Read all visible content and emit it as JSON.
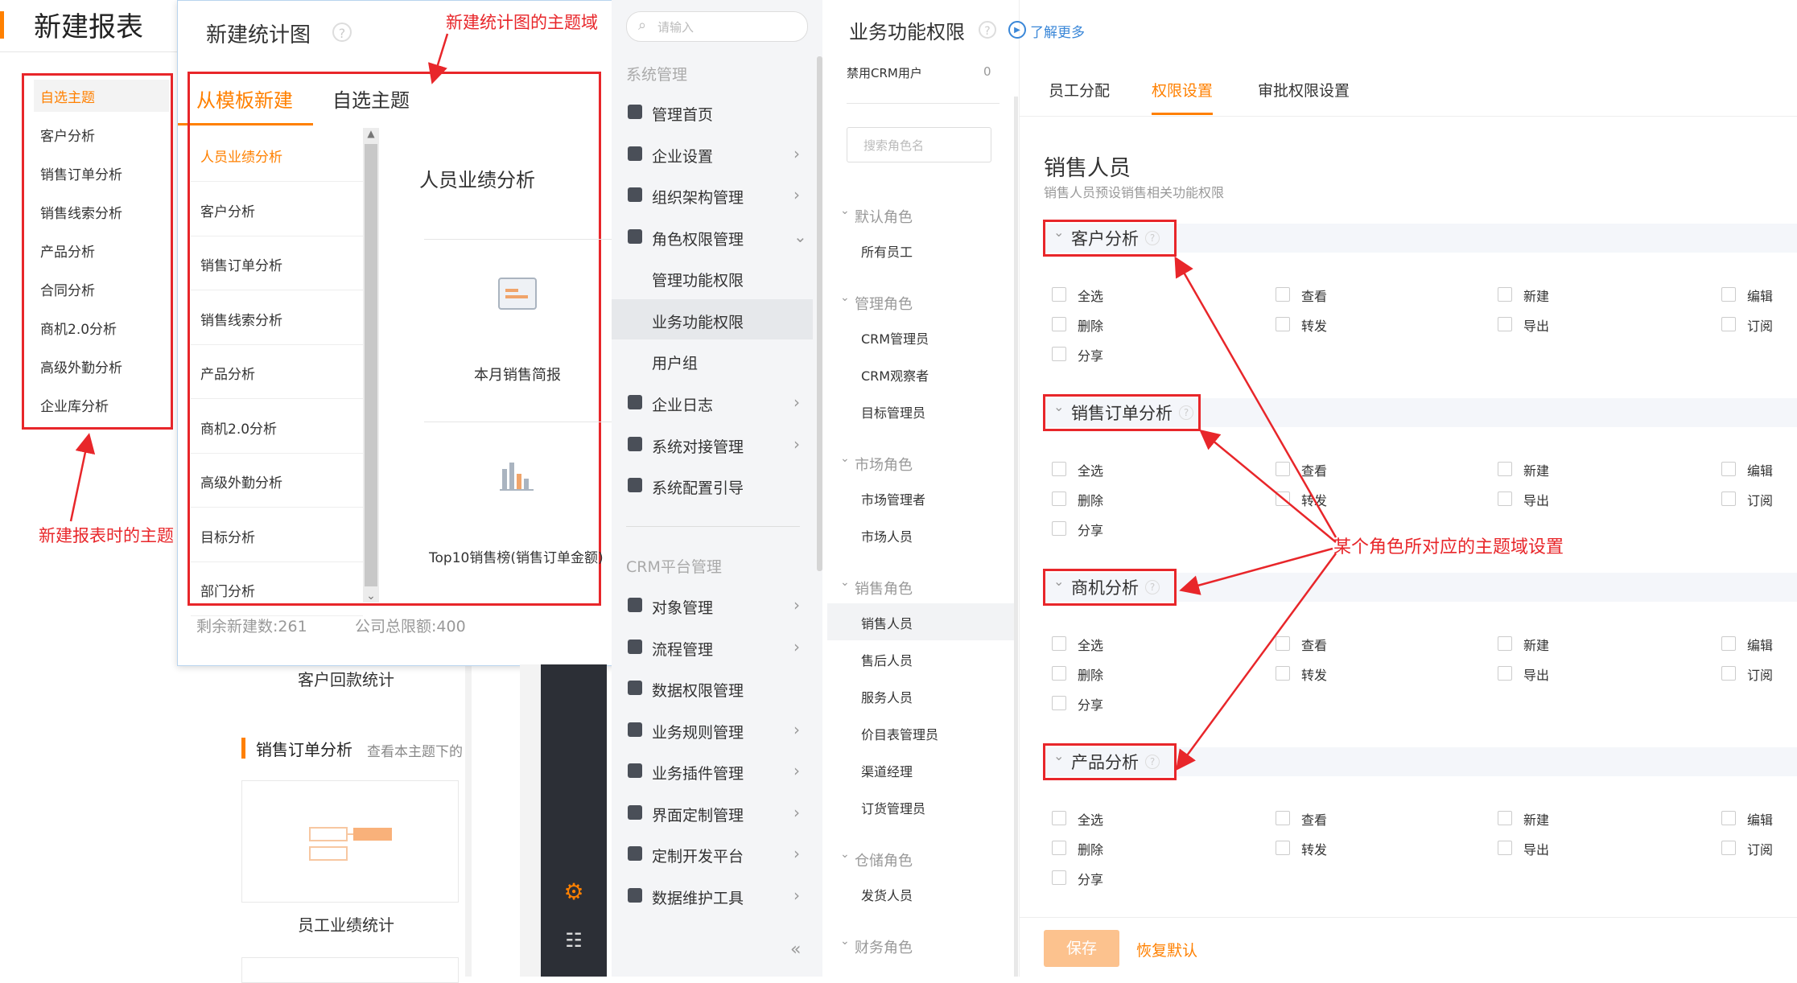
{
  "left_panel": {
    "title": "新建报表",
    "topics": [
      "自选主题",
      "客户分析",
      "销售订单分析",
      "销售线索分析",
      "产品分析",
      "合同分析",
      "商机2.0分析",
      "高级外勤分析",
      "企业库分析"
    ],
    "annotation": "新建报表时的主题",
    "card_customer_payment": "客户回款统计",
    "section_title": "销售订单分析",
    "section_hint": "查看本主题下的",
    "card_employee": "员工业绩统计"
  },
  "dialog": {
    "title": "新建统计图",
    "annotation": "新建统计图的主题域",
    "tab_template": "从模板新建",
    "tab_custom": "自选主题",
    "list": [
      "人员业绩分析",
      "客户分析",
      "销售订单分析",
      "销售线索分析",
      "产品分析",
      "商机2.0分析",
      "高级外勤分析",
      "目标分析",
      "部门分析"
    ],
    "preview_title": "人员业绩分析",
    "card_month": "本月销售简报",
    "card_top10": "Top10销售榜(销售订单金额)",
    "remaining": "剩余新建数:261",
    "limit": "公司总限额:400"
  },
  "sidebar": {
    "search_placeholder": "请输入",
    "group1": "系统管理",
    "items1": [
      {
        "label": "管理首页",
        "icon": "home-icon",
        "arrow": ""
      },
      {
        "label": "企业设置",
        "icon": "building-icon",
        "arrow": "›"
      },
      {
        "label": "组织架构管理",
        "icon": "org-icon",
        "arrow": "›"
      },
      {
        "label": "角色权限管理",
        "icon": "user-card-icon",
        "arrow": "⌄"
      }
    ],
    "sub_items": [
      "管理功能权限",
      "业务功能权限",
      "用户组"
    ],
    "items2": [
      {
        "label": "企业日志",
        "icon": "log-icon",
        "arrow": "›"
      },
      {
        "label": "系统对接管理",
        "icon": "link-icon",
        "arrow": "›"
      },
      {
        "label": "系统配置引导",
        "icon": "sliders-icon",
        "arrow": ""
      }
    ],
    "group2": "CRM平台管理",
    "items3": [
      {
        "label": "对象管理",
        "icon": "person-icon",
        "arrow": "›"
      },
      {
        "label": "流程管理",
        "icon": "flow-icon",
        "arrow": "›"
      },
      {
        "label": "数据权限管理",
        "icon": "lock-icon",
        "arrow": ""
      },
      {
        "label": "业务规则管理",
        "icon": "wrench-icon",
        "arrow": "›"
      },
      {
        "label": "业务插件管理",
        "icon": "puzzle-icon",
        "arrow": "›"
      },
      {
        "label": "界面定制管理",
        "icon": "brush-icon",
        "arrow": "›"
      },
      {
        "label": "定制开发平台",
        "icon": "monitor-icon",
        "arrow": "›"
      },
      {
        "label": "数据维护工具",
        "icon": "chart-icon",
        "arrow": "›"
      }
    ],
    "collapse": "«"
  },
  "roles": {
    "disabled_label": "禁用CRM用户",
    "disabled_count": "0",
    "search_placeholder": "搜索角色名",
    "groups": [
      {
        "name": "默认角色",
        "roles": [
          "所有员工"
        ]
      },
      {
        "name": "管理角色",
        "roles": [
          "CRM管理员",
          "CRM观察者",
          "目标管理员"
        ]
      },
      {
        "name": "市场角色",
        "roles": [
          "市场管理者",
          "市场人员"
        ]
      },
      {
        "name": "销售角色",
        "roles": [
          "销售人员",
          "售后人员",
          "服务人员",
          "价目表管理员",
          "渠道经理",
          "订货管理员"
        ]
      },
      {
        "name": "仓储角色",
        "roles": [
          "发货人员"
        ]
      },
      {
        "name": "财务角色",
        "roles": []
      }
    ]
  },
  "main": {
    "title": "业务功能权限",
    "learn_more": "了解更多",
    "tabs": [
      "员工分配",
      "权限设置",
      "审批权限设置"
    ],
    "active_tab": 1,
    "role_title": "销售人员",
    "role_desc": "销售人员预设销售相关功能权限",
    "sections": [
      "客户分析",
      "销售订单分析",
      "商机分析",
      "产品分析"
    ],
    "perms_row1": [
      "全选",
      "查看",
      "新建",
      "编辑"
    ],
    "perms_row2": [
      "删除",
      "转发",
      "导出",
      "订阅"
    ],
    "perms_row3": [
      "分享"
    ],
    "annotation": "某个角色所对应的主题域设置",
    "save": "保存",
    "reset": "恢复默认"
  },
  "colors": {
    "accent": "#ff8000",
    "annotation": "#e8262a",
    "link": "#3a87d8"
  }
}
